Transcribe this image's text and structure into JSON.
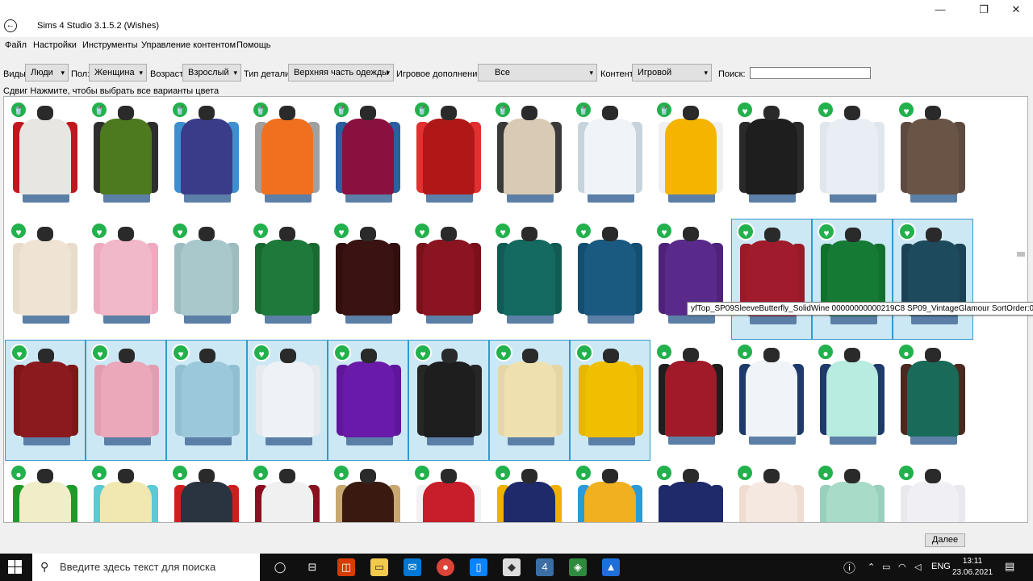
{
  "window": {
    "title": "Sims 4 Studio 3.1.5.2 (Wishes)",
    "minimize": "—",
    "maximize": "❐",
    "close": "✕"
  },
  "menu": [
    "Файл",
    "Настройки",
    "Инструменты",
    "Управление контентом",
    "Помощь"
  ],
  "filters": {
    "species_label": "Виды",
    "species_value": "Люди",
    "gender_label": "Пол:",
    "gender_value": "Женщина",
    "age_label": "Возраст:",
    "age_value": "Взрослый",
    "part_label": "Тип детали:",
    "part_value": "Верхняя часть одежды",
    "pack_label": "Игровое дополнение",
    "pack_value": "Все",
    "content_label": "Контент",
    "content_value": "Игровой",
    "search_label": "Поиск:",
    "search_value": ""
  },
  "hint": "Сдвиг Нажмите, чтобы выбрать все варианты цвета",
  "tooltip": "yfTop_SP09SleeveButterfly_SolidWine 00000000000219C8 SP09_VintageGlamour SortOrder:0-0",
  "next_button": "Далее",
  "items": [
    {
      "body": "#e8e6e2",
      "sleeve": "#c0181e",
      "badge": "drink-icon"
    },
    {
      "body": "#4d7a1e",
      "sleeve": "#2e2e2e",
      "badge": "drink-icon"
    },
    {
      "body": "#3a3c8a",
      "sleeve": "#3d8fd0",
      "badge": "drink-icon"
    },
    {
      "body": "#f07020",
      "sleeve": "#a0a0a0",
      "badge": "drink-icon"
    },
    {
      "body": "#8a1040",
      "sleeve": "#2a5fa0",
      "badge": "drink-icon"
    },
    {
      "body": "#b01818",
      "sleeve": "#e03030",
      "badge": "drink-icon"
    },
    {
      "body": "#d8cab4",
      "sleeve": "#3a3a3a",
      "badge": "drink-icon"
    },
    {
      "body": "#f0f4f8",
      "sleeve": "#c8d4dc",
      "badge": "drink-icon"
    },
    {
      "body": "#f4b400",
      "sleeve": "#f0f0f0",
      "badge": "drink-icon"
    },
    {
      "body": "#1e1e1e",
      "sleeve": "#2a2a2a",
      "badge": "tux-icon"
    },
    {
      "body": "#e8eef4",
      "sleeve": "#dfe6ec",
      "badge": "tux-icon"
    },
    {
      "body": "#6a5446",
      "sleeve": "#5e4a3e",
      "badge": "tux-icon"
    },
    {
      "body": "#efe4d4",
      "sleeve": "#e8dccb",
      "badge": "tux-icon"
    },
    {
      "body": "#f0b8c8",
      "sleeve": "#eeaabe",
      "badge": "tux-icon"
    },
    {
      "body": "#a8c8cc",
      "sleeve": "#9cbcc0",
      "badge": "tux-icon"
    },
    {
      "body": "#1e7a3a",
      "sleeve": "#186a30",
      "badge": "tux-icon"
    },
    {
      "body": "#3a1212",
      "sleeve": "#320e0e",
      "badge": "tux-icon"
    },
    {
      "body": "#8a1420",
      "sleeve": "#7a101a",
      "badge": "tux-icon"
    },
    {
      "body": "#146a60",
      "sleeve": "#105c54",
      "badge": "tux-icon"
    },
    {
      "body": "#1a5a80",
      "sleeve": "#144e70",
      "badge": "tux-icon"
    },
    {
      "body": "#5a2a8a",
      "sleeve": "#4e227a",
      "badge": "tux-icon"
    },
    {
      "body": "#a01c2c",
      "sleeve": "#9a1a28",
      "badge": "tux-icon",
      "selected": true
    },
    {
      "body": "#147a34",
      "sleeve": "#12702e",
      "badge": "tux-icon",
      "selected": true
    },
    {
      "body": "#1e4a5e",
      "sleeve": "#1a4254",
      "badge": "tux-icon",
      "selected": true
    },
    {
      "body": "#8a1a1e",
      "sleeve": "#801618",
      "badge": "tux-icon",
      "selected": true
    },
    {
      "body": "#eaa8ba",
      "sleeve": "#e29eb0",
      "badge": "tux-icon",
      "selected": true
    },
    {
      "body": "#9cc8dc",
      "sleeve": "#92bed2",
      "badge": "tux-icon",
      "selected": true
    },
    {
      "body": "#eef2f6",
      "sleeve": "#e6eaee",
      "badge": "tux-icon",
      "selected": true
    },
    {
      "body": "#6a1aa8",
      "sleeve": "#60169a",
      "badge": "tux-icon",
      "selected": true
    },
    {
      "body": "#1e1e1e",
      "sleeve": "#262626",
      "badge": "tux-icon",
      "selected": true
    },
    {
      "body": "#efe0b0",
      "sleeve": "#e6d6a6",
      "badge": "tux-icon",
      "selected": true
    },
    {
      "body": "#f0c000",
      "sleeve": "#e6b600",
      "badge": "tux-icon",
      "selected": true
    },
    {
      "body": "#a01a2a",
      "sleeve": "#1e1e1e",
      "badge": "bowling-icon"
    },
    {
      "body": "#f0f4f8",
      "sleeve": "#1e3a6a",
      "badge": "bowling-icon"
    },
    {
      "body": "#b8ece0",
      "sleeve": "#1e3a6a",
      "badge": "bowling-icon"
    },
    {
      "body": "#1a6a5a",
      "sleeve": "#4a2a20",
      "badge": "bowling-icon"
    },
    {
      "body": "#f0eec8",
      "sleeve": "#1e9a2a",
      "badge": "bowling-icon"
    },
    {
      "body": "#f0e8b0",
      "sleeve": "#5acad4",
      "badge": "bowling-icon"
    },
    {
      "body": "#2a3440",
      "sleeve": "#d01e1e",
      "badge": "bowling-icon"
    },
    {
      "body": "#f0f0f0",
      "sleeve": "#8a1020",
      "badge": "bowling-icon"
    },
    {
      "body": "#3a1a10",
      "sleeve": "#c8a870",
      "badge": "bowling-icon"
    },
    {
      "body": "#c81e2a",
      "sleeve": "#f0f2f4",
      "badge": "bowling-icon"
    },
    {
      "body": "#1e2a6a",
      "sleeve": "#f0b000",
      "badge": "bowling-icon"
    },
    {
      "body": "#f0b020",
      "sleeve": "#2a9ad8",
      "badge": "bowling-icon"
    },
    {
      "body": "#1e2a6a",
      "sleeve": "#1e2a6a",
      "badge": "bowling-icon"
    },
    {
      "body": "#f4e8e0",
      "sleeve": "#f0dcd0",
      "badge": "bowling-icon"
    },
    {
      "body": "#a8dcc8",
      "sleeve": "#98d0bc",
      "badge": "bowling-icon"
    },
    {
      "body": "#f0f0f4",
      "sleeve": "#e8e8ee",
      "badge": "bowling-icon"
    }
  ],
  "taskbar": {
    "search_placeholder": "Введите здесь текст для поиска",
    "lang": "ENG",
    "time": "13:11",
    "date": "23.06.2021",
    "apps": [
      "cortana-icon",
      "taskview-icon",
      "office-icon",
      "explorer-icon",
      "mail-icon",
      "chrome-icon",
      "phone-icon",
      "package-icon",
      "sims4studio-icon",
      "maps-icon",
      "photos-icon"
    ]
  }
}
